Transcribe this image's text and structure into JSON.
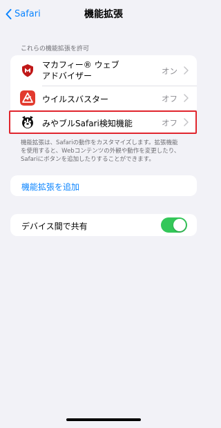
{
  "nav": {
    "back_label": "Safari",
    "title": "機能拡張"
  },
  "section": {
    "header": "これらの機能拡張を許可"
  },
  "extensions": [
    {
      "line1": "マカフィー® ウェブ",
      "line2": "アドバイザー",
      "status": "オン",
      "icon": "mcafee-icon"
    },
    {
      "line1": "ウイルスバスター",
      "status": "オフ",
      "icon": "virusbuster-icon"
    },
    {
      "line1": "みやブルSafari検知機能",
      "status": "オフ",
      "icon": "miyaburu-icon"
    }
  ],
  "description": {
    "line1": "機能拡張は、Safariの動作をカスタマイズします。拡張機能",
    "line2": "を使用すると、Webコンテンツの外観や動作を変更したり、",
    "line3": "Safariにボタンを追加したりすることができます。"
  },
  "add_button": {
    "label": "機能拡張を追加"
  },
  "share": {
    "label": "デバイス間で共有",
    "enabled": true
  },
  "colors": {
    "accent": "#0a84ff",
    "toggle_on": "#34c759",
    "highlight": "#e0242c"
  }
}
